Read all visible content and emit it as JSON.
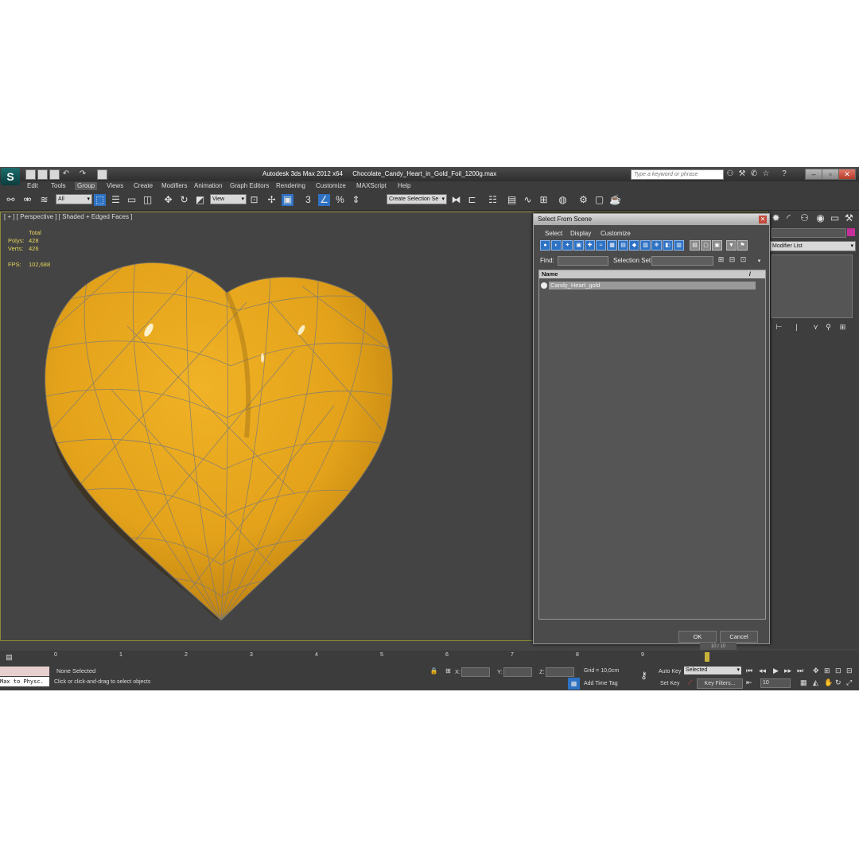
{
  "window": {
    "app_title": "Autodesk 3ds Max  2012 x64",
    "file_title": "Chocolate_Candy_Heart_in_Gold_Foil_1200g.max",
    "search_placeholder": "Type a keyword or phrase"
  },
  "menus": [
    "Edit",
    "Tools",
    "Group",
    "Views",
    "Create",
    "Modifiers",
    "Animation",
    "Graph Editors",
    "Rendering",
    "Customize",
    "MAXScript",
    "Help"
  ],
  "toolbar": {
    "filter_value": "All",
    "coord_value": "View",
    "snap_label": "3",
    "selection_set_placeholder": "Create Selection Se"
  },
  "viewport": {
    "label": "[ + ] [ Perspective ] [ Shaded + Edged Faces ]",
    "total_label": "Total",
    "polys_label": "Polys:",
    "polys_value": "428",
    "verts_label": "Verts:",
    "verts_value": "426",
    "fps_label": "FPS:",
    "fps_value": "102,688"
  },
  "command_panel": {
    "modifier_list": "Modifier List",
    "color": "#c3309a"
  },
  "dialog": {
    "title": "Select From Scene",
    "menus": [
      "Select",
      "Display",
      "Customize"
    ],
    "find_label": "Find:",
    "selection_set_label": "Selection Set:",
    "column_name": "Name",
    "column_sort": "/",
    "items": [
      "Candy_Heart_gold"
    ],
    "ok_label": "OK",
    "cancel_label": "Cancel"
  },
  "timeline": {
    "ticks": [
      "0",
      "1",
      "2",
      "3",
      "4",
      "5",
      "6",
      "7",
      "8",
      "9"
    ],
    "slider_label": "10 / 10"
  },
  "status": {
    "listener_text": "Max to Physc.",
    "selection_status": "None Selected",
    "prompt": "Click or click-and-drag to select objects",
    "x_label": "X:",
    "y_label": "Y:",
    "z_label": "Z:",
    "grid": "Grid = 10,0cm",
    "add_time_tag": "Add Time Tag",
    "auto_key": "Auto Key",
    "set_key": "Set Key",
    "selected_value": "Selected",
    "key_filters": "Key Filters...",
    "frame_value": "10"
  },
  "colors": {
    "heart_fill": "#e3a21a",
    "accent_blue": "#2e72c4",
    "viewport_bg": "#444444"
  }
}
